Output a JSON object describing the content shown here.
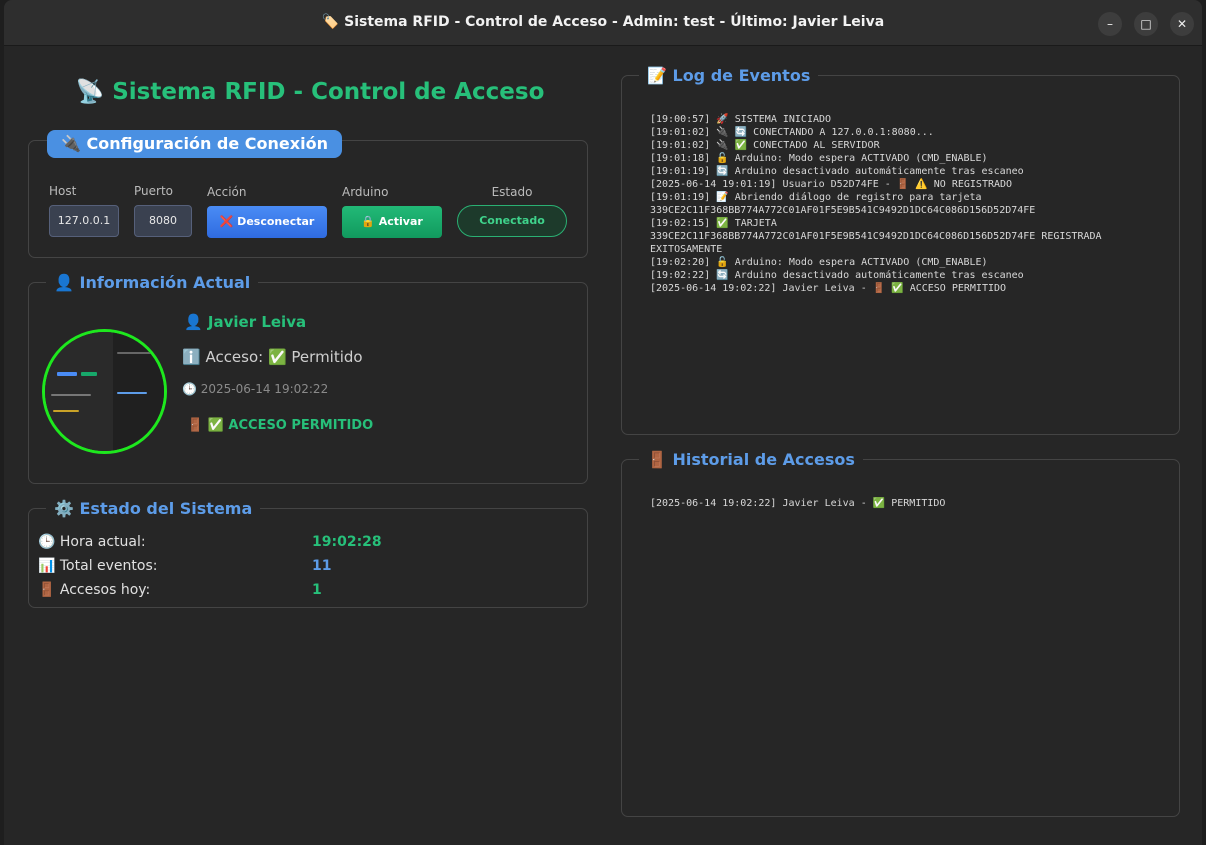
{
  "window": {
    "title": "🏷️ Sistema RFID - Control de Acceso - Admin: test - Último: Javier Leiva",
    "minimize_glyph": "–",
    "maximize_glyph": "□",
    "close_glyph": "✕"
  },
  "app_title": "📡 Sistema RFID - Control de Acceso",
  "connection": {
    "legend": "🔌 Configuración de Conexión",
    "host_label": "Host",
    "host_value": "127.0.0.1",
    "port_label": "Puerto",
    "port_value": "8080",
    "action_label": "Acción",
    "action_button": "❌ Desconectar",
    "arduino_label": "Arduino",
    "arduino_button": "🔒 Activar",
    "status_label": "Estado",
    "status_value": "Conectado"
  },
  "current_info": {
    "legend": "👤 Información Actual",
    "user": "👤 Javier Leiva",
    "access": "ℹ️ Acceso: ✅ Permitido",
    "timestamp": "🕒 2025-06-14 19:02:22",
    "result": "🚪 ✅ ACCESO PERMITIDO"
  },
  "system_status": {
    "legend": "⚙️ Estado del Sistema",
    "rows": [
      {
        "label": "🕒 Hora actual:",
        "value": "19:02:28",
        "color": "#27c07a"
      },
      {
        "label": "📊 Total eventos:",
        "value": "11",
        "color": "#5d9ce8"
      },
      {
        "label": "🚪 Accesos hoy:",
        "value": "1",
        "color": "#27c07a"
      }
    ]
  },
  "event_log": {
    "legend": "📝 Log de Eventos",
    "lines": [
      "[19:00:57] 🚀 SISTEMA INICIADO",
      "[19:01:02] 🔌 🔄 CONECTANDO A 127.0.0.1:8080...",
      "[19:01:02] 🔌 ✅ CONECTADO AL SERVIDOR",
      "[19:01:18] 🔓 Arduino: Modo espera ACTIVADO (CMD_ENABLE)",
      "[19:01:19] 🔄 Arduino desactivado automáticamente tras escaneo",
      "[2025-06-14 19:01:19] Usuario D52D74FE - 🚪 ⚠️ NO REGISTRADO",
      "[19:01:19] 📝 Abriendo diálogo de registro para tarjeta",
      "339CE2C11F368BB774A772C01AF01F5E9B541C9492D1DC64C086D156D52D74FE",
      "[19:02:15] ✅ TARJETA",
      "339CE2C11F368BB774A772C01AF01F5E9B541C9492D1DC64C086D156D52D74FE REGISTRADA",
      "EXITOSAMENTE",
      "[19:02:20] 🔓 Arduino: Modo espera ACTIVADO (CMD_ENABLE)",
      "[19:02:22] 🔄 Arduino desactivado automáticamente tras escaneo",
      "[2025-06-14 19:02:22] Javier Leiva - 🚪 ✅ ACCESO PERMITIDO"
    ]
  },
  "access_history": {
    "legend": "🚪 Historial de Accesos",
    "lines": [
      "[2025-06-14 19:02:22] Javier Leiva - ✅ PERMITIDO"
    ]
  },
  "colors": {
    "accent_blue": "#5d9ce8",
    "accent_green": "#27c07a",
    "photo_ring": "#1ee81e",
    "disconnect_button": "#3b7cf0",
    "activate_button": "#17a86a"
  }
}
